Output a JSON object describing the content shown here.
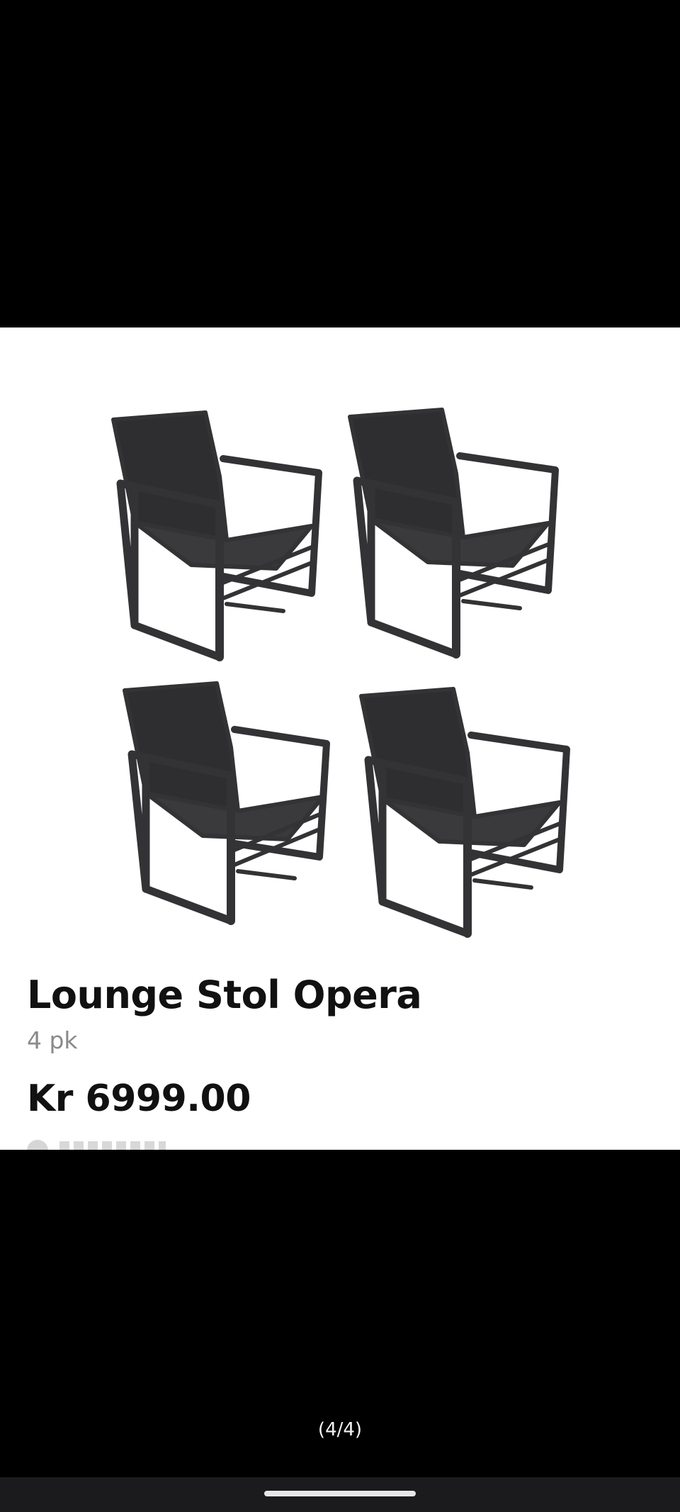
{
  "product": {
    "title": "Lounge Stol Opera",
    "quantity": "4 pk",
    "price": "Kr 6999.00",
    "chair_color": "#3a3a3c"
  },
  "viewer": {
    "page_counter": "(4/4)"
  },
  "icons": {
    "home_indicator": "home-indicator-bar"
  }
}
